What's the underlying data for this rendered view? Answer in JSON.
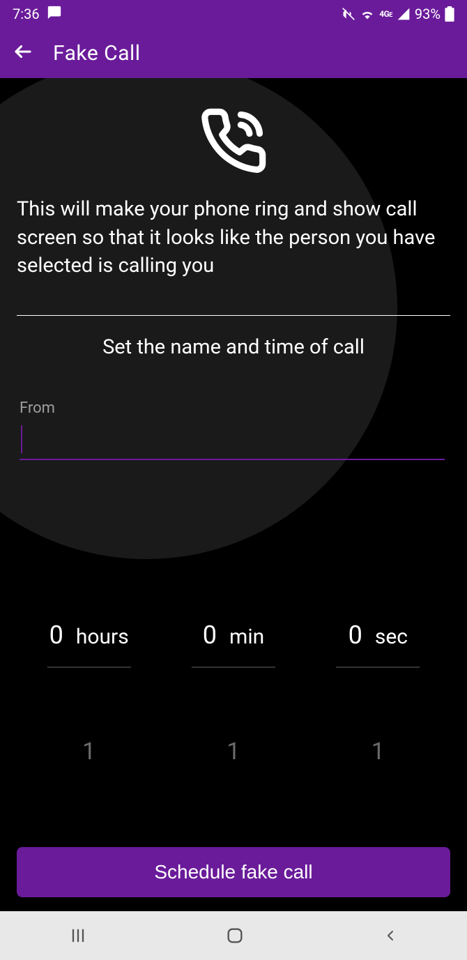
{
  "status": {
    "time": "7:36",
    "battery_pct": "93%",
    "network_label": "4G"
  },
  "appbar": {
    "title": "Fake Call"
  },
  "main": {
    "description": "This will make your phone ring and show call screen so that it looks like the person you have selected is calling you",
    "subtitle": "Set the name and time of call",
    "from_label": "From",
    "from_value": "",
    "picker": {
      "hours": {
        "value": "0",
        "unit": "hours",
        "next": "1"
      },
      "min": {
        "value": "0",
        "unit": "min",
        "next": "1"
      },
      "sec": {
        "value": "0",
        "unit": "sec",
        "next": "1"
      }
    },
    "schedule_label": "Schedule fake call"
  }
}
